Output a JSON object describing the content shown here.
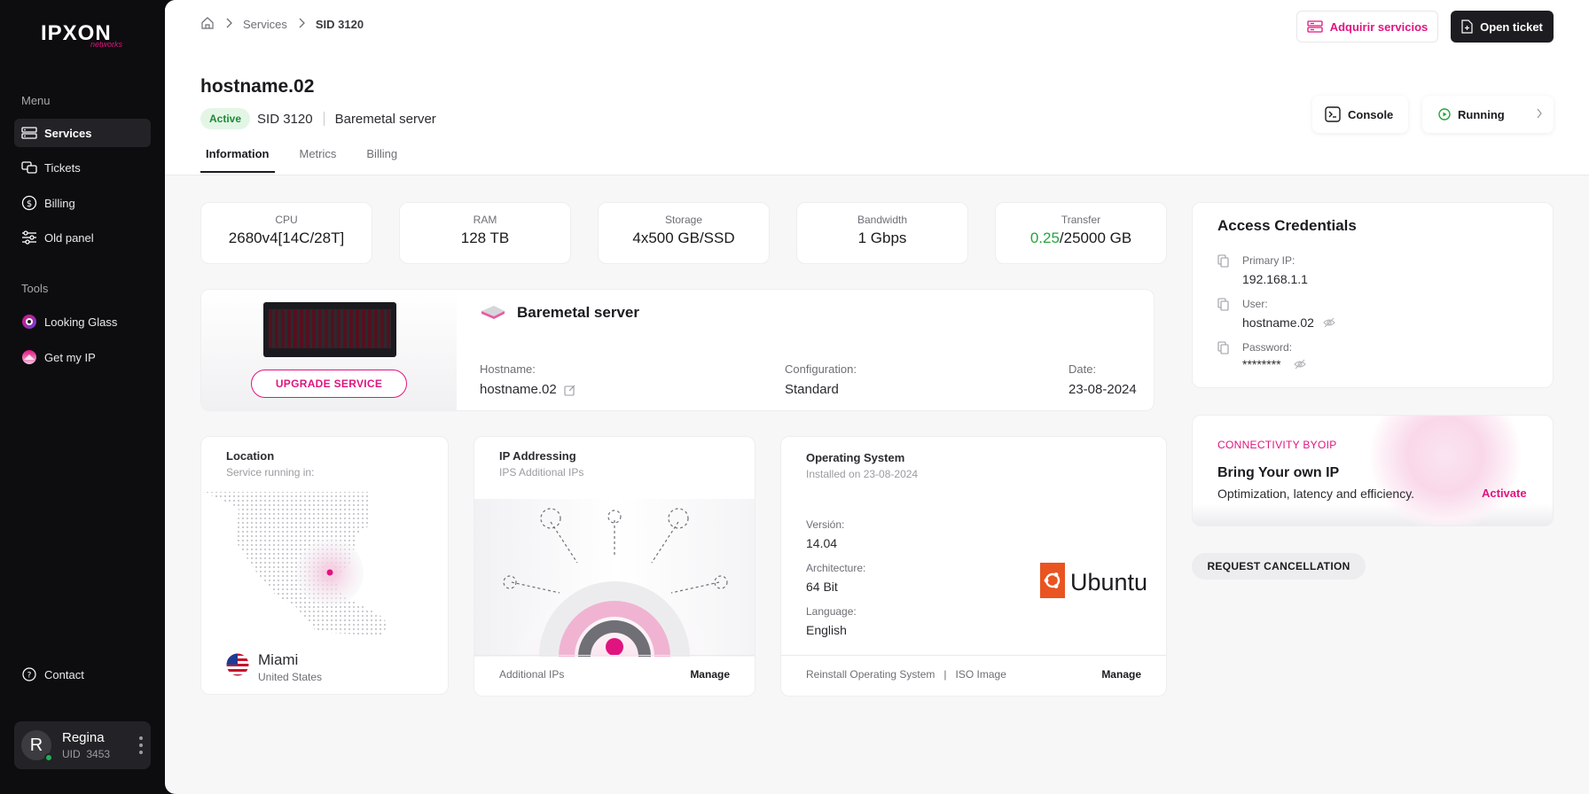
{
  "brand": {
    "name": "IPXON",
    "tagline": "networks"
  },
  "sidebar": {
    "menu_title": "Menu",
    "items": [
      {
        "label": "Services",
        "icon": "server-icon",
        "active": true
      },
      {
        "label": "Tickets",
        "icon": "tickets-icon"
      },
      {
        "label": "Billing",
        "icon": "dollar-icon"
      },
      {
        "label": "Old panel",
        "icon": "sliders-icon"
      }
    ],
    "tools_title": "Tools",
    "tools": [
      {
        "label": "Looking Glass",
        "icon": "looking-glass-icon"
      },
      {
        "label": "Get my IP",
        "icon": "get-my-ip-icon"
      }
    ],
    "contact": "Contact",
    "user": {
      "initial": "R",
      "name": "Regina",
      "uid_label": "UID",
      "uid": "3453",
      "status": "online"
    }
  },
  "topbar": {
    "breadcrumb": [
      "Services",
      "SID 3120"
    ],
    "buy_label": "Adquirir servicios",
    "ticket_label": "Open ticket"
  },
  "header": {
    "hostname": "hostname.02",
    "status": "Active",
    "sid_label": "SID",
    "sid": "3120",
    "type": "Baremetal server",
    "console_label": "Console",
    "power_label": "Running",
    "tabs": [
      "Information",
      "Metrics",
      "Billing"
    ],
    "active_tab": "Information"
  },
  "specs": [
    {
      "label": "CPU",
      "value": "2680v4[14C/28T]"
    },
    {
      "label": "RAM",
      "value": "128 TB"
    },
    {
      "label": "Storage",
      "value": "4x500 GB/SSD"
    },
    {
      "label": "Bandwidth",
      "value": "1 Gbps"
    },
    {
      "label": "Transfer",
      "used": "0.25",
      "total": "/25000 GB"
    }
  ],
  "server": {
    "title": "Baremetal server",
    "upgrade_label": "UPGRADE SERVICE",
    "hostname_label": "Hostname:",
    "hostname": "hostname.02",
    "config_label": "Configuration:",
    "config": "Standard",
    "date_label": "Date:",
    "date": "23-08-2024"
  },
  "credentials": {
    "title": "Access Credentials",
    "ip_label": "Primary IP:",
    "ip": "192.168.1.1",
    "user_label": "User:",
    "user": "hostname.02",
    "password_label": "Password:",
    "password": "********"
  },
  "byoip": {
    "kicker": "CONNECTIVITY BYOIP",
    "title": "Bring Your own IP",
    "subtitle": "Optimization, latency and efficiency.",
    "action": "Activate"
  },
  "cancel_label": "REQUEST CANCELLATION",
  "location": {
    "title": "Location",
    "subtitle": "Service running in:",
    "city": "Miami",
    "country": "United States"
  },
  "ip_addressing": {
    "title": "IP Addressing",
    "subtitle": "IPS Additional IPs",
    "footer": "Additional IPs",
    "action": "Manage"
  },
  "os": {
    "title": "Operating System",
    "subtitle": "Installed on 23-08-2024",
    "version_label": "Versión:",
    "version": "14.04",
    "arch_label": "Architecture:",
    "arch": "64 Bit",
    "lang_label": "Language:",
    "lang": "English",
    "logo_text": "Ubuntu",
    "reinstall": "Reinstall Operating System",
    "iso": "ISO Image",
    "action": "Manage"
  },
  "colors": {
    "accent": "#e0147f",
    "dark": "#1d1d21",
    "success": "#24a53e"
  }
}
